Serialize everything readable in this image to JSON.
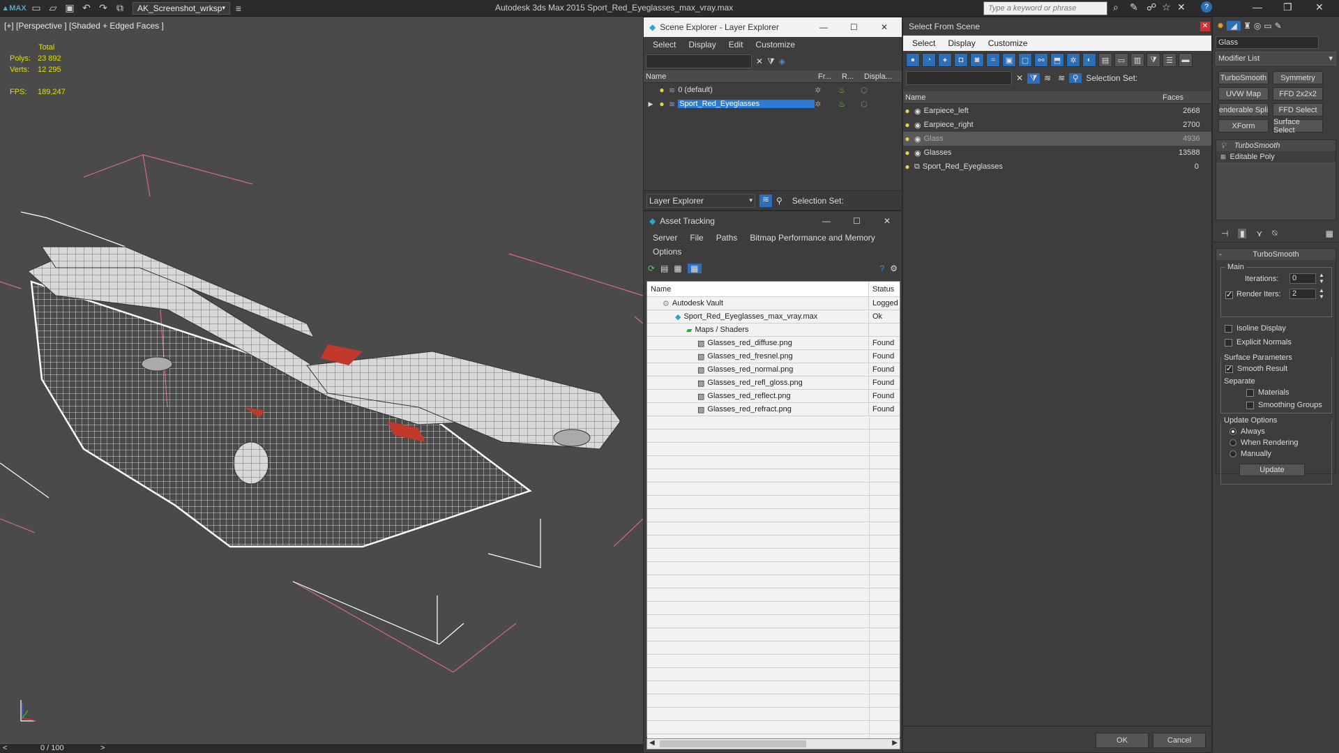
{
  "app": {
    "workspace": "AK_Screenshot_wrksp",
    "title": "Autodesk 3ds Max  2015    Sport_Red_Eyeglasses_max_vray.max",
    "search_placeholder": "Type a keyword or phrase"
  },
  "viewport": {
    "label": "[+] [Perspective ] [Shaded + Edged Faces ]",
    "stats": {
      "total_label": "Total",
      "polys_label": "Polys:",
      "polys_value": "23 892",
      "verts_label": "Verts:",
      "verts_value": "12 295",
      "fps_label": "FPS:",
      "fps_value": "189,247"
    },
    "timeline": "0 / 100"
  },
  "scene_explorer": {
    "title": "Scene Explorer - Layer Explorer",
    "menu": [
      "Select",
      "Display",
      "Edit",
      "Customize"
    ],
    "columns": [
      "Name",
      "Fr...",
      "R...",
      "Displa..."
    ],
    "rows": [
      {
        "name": "0 (default)"
      },
      {
        "name": "Sport_Red_Eyeglasses"
      }
    ],
    "footer_dropdown": "Layer Explorer",
    "selection_set_label": "Selection Set:"
  },
  "asset_tracking": {
    "title": "Asset Tracking",
    "menu": [
      "Server",
      "File",
      "Paths",
      "Bitmap Performance and Memory"
    ],
    "menu2": [
      "Options"
    ],
    "columns": [
      "Name",
      "Status"
    ],
    "rows": [
      {
        "name": "Autodesk Vault",
        "status": "Logged"
      },
      {
        "name": "Sport_Red_Eyeglasses_max_vray.max",
        "status": "Ok"
      },
      {
        "name": "Maps / Shaders",
        "status": ""
      },
      {
        "name": "Glasses_red_diffuse.png",
        "status": "Found"
      },
      {
        "name": "Glasses_red_fresnel.png",
        "status": "Found"
      },
      {
        "name": "Glasses_red_normal.png",
        "status": "Found"
      },
      {
        "name": "Glasses_red_refl_gloss.png",
        "status": "Found"
      },
      {
        "name": "Glasses_red_reflect.png",
        "status": "Found"
      },
      {
        "name": "Glasses_red_refract.png",
        "status": "Found"
      }
    ]
  },
  "select_from_scene": {
    "title": "Select From Scene",
    "menu": [
      "Select",
      "Display",
      "Customize"
    ],
    "selection_set_label": "Selection Set:",
    "columns": [
      "Name",
      "Faces"
    ],
    "rows": [
      {
        "name": "Earpiece_left",
        "faces": "2668"
      },
      {
        "name": "Earpiece_right",
        "faces": "2700"
      },
      {
        "name": "Glass",
        "faces": "4936"
      },
      {
        "name": "Glasses",
        "faces": "13588"
      },
      {
        "name": "Sport_Red_Eyeglasses",
        "faces": "0"
      }
    ],
    "ok": "OK",
    "cancel": "Cancel"
  },
  "command_panel": {
    "object_name": "Glass",
    "modifier_list": "Modifier List",
    "buttons": [
      "TurboSmooth",
      "Symmetry",
      "UVW Map",
      "FFD 2x2x2",
      "enderable Spli",
      "FFD Select",
      "XForm",
      "Surface Select"
    ],
    "stack": [
      "TurboSmooth",
      "Editable Poly"
    ],
    "rollout_title": "TurboSmooth",
    "main_label": "Main",
    "iterations_label": "Iterations:",
    "iterations_value": "0",
    "render_iters_label": "Render Iters:",
    "render_iters_value": "2",
    "isoline": "Isoline Display",
    "explicit_normals": "Explicit Normals",
    "surface_params": "Surface Parameters",
    "smooth_result": "Smooth Result",
    "separate": "Separate",
    "materials": "Materials",
    "smoothing_groups": "Smoothing Groups",
    "update_options": "Update Options",
    "always": "Always",
    "when_rendering": "When Rendering",
    "manually": "Manually",
    "update": "Update"
  }
}
